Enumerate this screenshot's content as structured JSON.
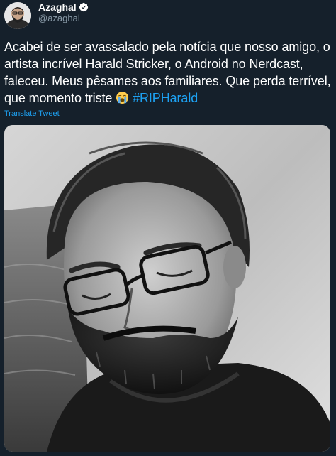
{
  "author": {
    "display_name": "Azaghal",
    "handle": "@azaghal",
    "verified_icon": "verified-badge-icon",
    "avatar_icon": "avatar"
  },
  "tweet": {
    "text_part1": "Acabei de ser avassalado pela notícia que nosso amigo, o artista incrível Harald Stricker, o Android no Nerdcast, faleceu. Meus pêsames aos familiares. Que perda terrível, que momento triste ",
    "emoji": "loudly-crying-face-icon",
    "hashtag": "#RIPHarald",
    "translate_label": "Translate Tweet"
  },
  "media": {
    "type": "photo",
    "tone": "black-and-white"
  },
  "colors": {
    "background": "#15202b",
    "text": "#ffffff",
    "link": "#1da1f2",
    "secondary": "#8899a6"
  }
}
